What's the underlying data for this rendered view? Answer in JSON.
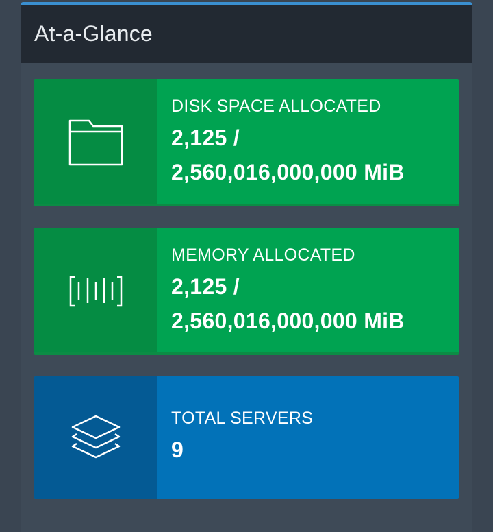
{
  "panel": {
    "title": "At-a-Glance"
  },
  "stats": [
    {
      "label": "DISK SPACE ALLOCATED",
      "value_line1": "2,125 /",
      "value_line2": "2,560,016,000,000 MiB",
      "icon": "folder-icon"
    },
    {
      "label": "MEMORY ALLOCATED",
      "value_line1": "2,125 /",
      "value_line2": "2,560,016,000,000 MiB",
      "icon": "memory-icon"
    },
    {
      "label": "TOTAL SERVERS",
      "value_line1": "9",
      "icon": "layers-icon"
    }
  ],
  "colors": {
    "green": "#00a351",
    "green_dark": "#058c43",
    "blue": "#0272b8",
    "blue_dark": "#045a94",
    "header": "#222932",
    "accent": "#3a8fd0"
  }
}
